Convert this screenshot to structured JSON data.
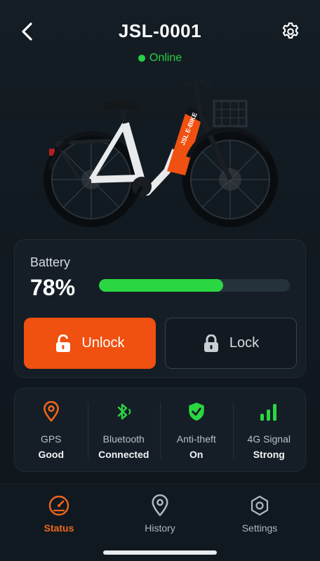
{
  "header": {
    "title": "JSL-0001",
    "status": "Online",
    "status_color": "#28d043",
    "back_icon": "chevron-left-icon",
    "settings_icon": "gear-icon"
  },
  "bike": {
    "image": "electric-bike",
    "frame_text": "JSL E-BIKE",
    "accent_color": "#f05010"
  },
  "battery": {
    "label": "Battery",
    "value": "78%",
    "level": 0.65,
    "fill_color": "#2bd643"
  },
  "actions": {
    "unlock_label": "Unlock",
    "lock_label": "Lock",
    "unlock_color": "#f05010"
  },
  "info": [
    {
      "icon": "location-pin-icon",
      "title": "GPS",
      "value": "Good",
      "color": "#f0661c"
    },
    {
      "icon": "bluetooth-icon",
      "title": "Bluetooth",
      "value": "Connected",
      "color": "#2bd643"
    },
    {
      "icon": "shield-check-icon",
      "title": "Anti-theft",
      "value": "On",
      "color": "#2bd643"
    },
    {
      "icon": "signal-bars-icon",
      "title": "4G Signal",
      "value": "Strong",
      "color": "#2bd643"
    }
  ],
  "tabs": [
    {
      "icon": "speedometer-icon",
      "label": "Status",
      "active": true
    },
    {
      "icon": "map-pin-icon",
      "label": "History",
      "active": false
    },
    {
      "icon": "hex-settings-icon",
      "label": "Settings",
      "active": false
    }
  ]
}
